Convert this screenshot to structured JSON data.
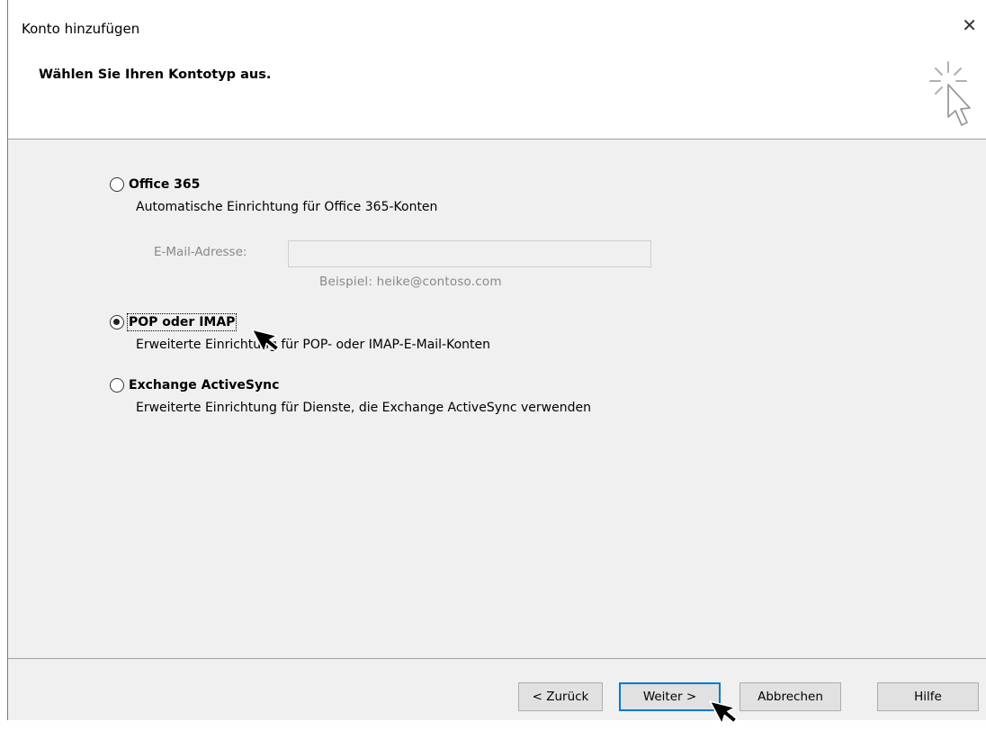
{
  "window": {
    "title": "Konto hinzufügen",
    "close_glyph": "✕"
  },
  "header": {
    "heading": "Wählen Sie Ihren Kontotyp aus.",
    "icon": "wizard-cursor-icon"
  },
  "options": [
    {
      "label": "Office 365",
      "description": "Automatische Einrichtung für Office 365-Konten",
      "selected": false
    },
    {
      "label": "POP oder IMAP",
      "description": "Erweiterte Einrichtung für POP- oder IMAP-E-Mail-Konten",
      "selected": true
    },
    {
      "label": "Exchange ActiveSync",
      "description": "Erweiterte Einrichtung für Dienste, die Exchange ActiveSync verwenden",
      "selected": false
    }
  ],
  "email": {
    "label": "E-Mail-Adresse:",
    "value": "",
    "example": "Beispiel: heike@contoso.com"
  },
  "buttons": {
    "back": "< Zurück",
    "next": "Weiter >",
    "cancel": "Abbrechen",
    "help": "Hilfe"
  },
  "colors": {
    "dialog_bg": "#f0f0f0",
    "header_bg": "#ffffff",
    "default_button_border": "#0078d7",
    "disabled_text": "#888888"
  }
}
